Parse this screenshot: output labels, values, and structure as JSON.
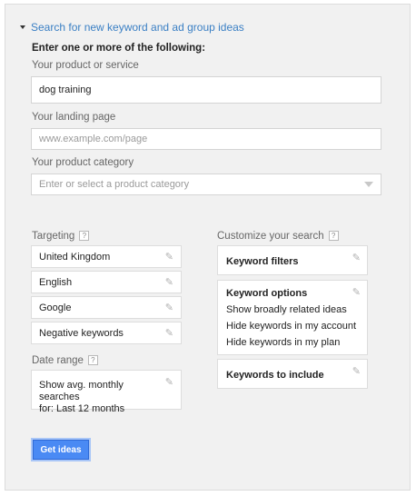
{
  "section": {
    "title": "Search for new keyword and ad group ideas"
  },
  "instructions": "Enter one or more of the following:",
  "product": {
    "label": "Your product or service",
    "value": "dog training"
  },
  "landing": {
    "label": "Your landing page",
    "placeholder": "www.example.com/page"
  },
  "category": {
    "label": "Your product category",
    "placeholder": "Enter or select a product category"
  },
  "targeting": {
    "label": "Targeting",
    "items": [
      "United Kingdom",
      "English",
      "Google",
      "Negative keywords"
    ]
  },
  "date_range": {
    "label": "Date range",
    "line1": "Show avg. monthly searches",
    "line2": "for: Last 12 months"
  },
  "customize": {
    "label": "Customize your search",
    "filters": "Keyword filters",
    "options": {
      "title": "Keyword options",
      "lines": [
        "Show broadly related ideas",
        "Hide keywords in my account",
        "Hide keywords in my plan"
      ]
    },
    "include": "Keywords to include"
  },
  "help_glyph": "?",
  "button": {
    "label": "Get ideas"
  }
}
